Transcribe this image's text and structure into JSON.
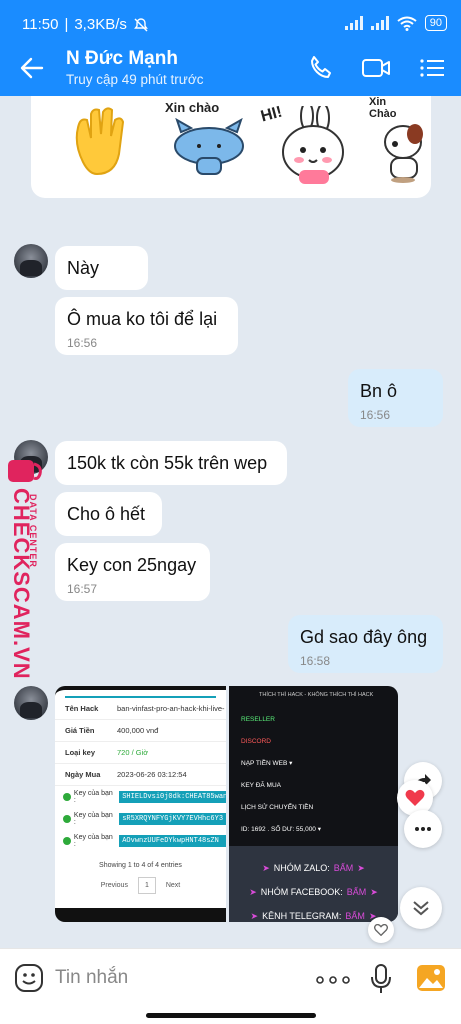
{
  "status_bar": {
    "time": "11:50",
    "speed": "3,3KB/s",
    "battery": "90"
  },
  "header": {
    "name": "N Đức Mạnh",
    "subtitle": "Truy cập 49 phút trước"
  },
  "stickers": [
    {
      "icon": "waving-hand-icon",
      "label": ""
    },
    {
      "icon": "cat-hello-icon",
      "label": "Xin chào"
    },
    {
      "icon": "bunny-hi-icon",
      "label": "HI!"
    },
    {
      "icon": "dog-hello-icon",
      "label": "Xin Chào"
    }
  ],
  "messages": [
    {
      "dir": "in",
      "text": "Này",
      "time": ""
    },
    {
      "dir": "in",
      "text": "Ô mua ko tôi để lại",
      "time": "16:56"
    },
    {
      "dir": "out",
      "text": "Bn ô",
      "time": "16:56"
    },
    {
      "dir": "in",
      "text": "150k tk còn 55k trên wep",
      "time": ""
    },
    {
      "dir": "in",
      "text": "Cho ô hết",
      "time": ""
    },
    {
      "dir": "in",
      "text": "Key con 25ngay",
      "time": "16:57"
    },
    {
      "dir": "out",
      "text": "Gd sao đây ông",
      "time": "16:58"
    }
  ],
  "image_left": {
    "rows": [
      {
        "k": "Tên Hack",
        "v": "ban-vinfast-pro-an-hack-khi-live-"
      },
      {
        "k": "Giá Tiền",
        "v": "400,000 vnđ"
      },
      {
        "k": "Loại key",
        "v": "720 / Giờ"
      },
      {
        "k": "Ngày Mua",
        "v": "2023-06-26 03:12:54"
      }
    ],
    "key_label": "Key của bạn :",
    "keys": [
      "SHIELDvsi0j0dk:CHEAT85wan1",
      "sR5XRQYNFYGjKVY7EVHhc6Y3",
      "AOvwnzUUFeDYkwpHNT48sZN"
    ],
    "footer": "Showing 1 to 4 of 4 entries",
    "prev": "Previous",
    "page": "1",
    "next": "Next"
  },
  "image_right": {
    "title": "THÍCH THÌ HACK - KHÔNG THÍCH THÌ HACK",
    "menu": [
      "RESELLER",
      "DISCORD",
      "NẠP TIỀN WEB ▾",
      "KEY ĐÃ MUA",
      "LỊCH SỬ CHUYỂN TIỀN"
    ],
    "account": "ID: 1692 . SỐ DƯ: 55,000 ▾",
    "links": [
      {
        "label": "NHÓM ZALO:",
        "action": "BẤM"
      },
      {
        "label": "NHÓM FACEBOOK:",
        "action": "BẤM"
      },
      {
        "label": "KÊNH TELEGRAM:",
        "action": "BẤM"
      }
    ]
  },
  "watermark": {
    "big": "CHECKSCAM.VN",
    "small": "DATA CENTER"
  },
  "input": {
    "placeholder": "Tin nhắn"
  }
}
